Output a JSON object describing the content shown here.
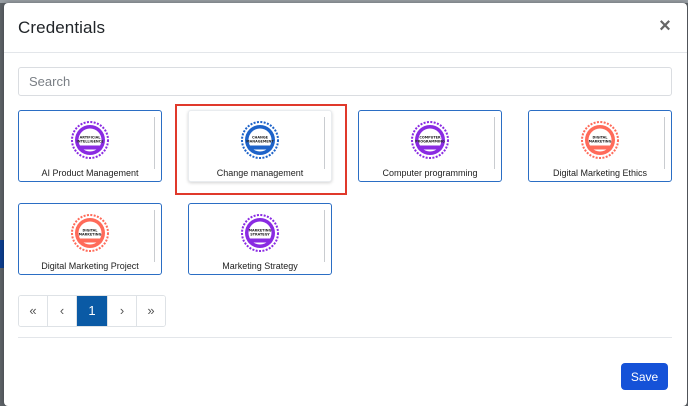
{
  "dialog": {
    "title": "Credentials",
    "close_glyph": "×",
    "search_placeholder": "Search",
    "save_label": "Save"
  },
  "credentials": [
    {
      "label": "AI Product Management",
      "badge_text": [
        "ARTIFICIAL",
        "INTELLIGENCE"
      ],
      "badge_color": "#8a2be2",
      "selected": false
    },
    {
      "label": "Change management",
      "badge_text": [
        "CHANGE",
        "MANAGEMENT"
      ],
      "badge_color": "#1e63c9",
      "selected": true
    },
    {
      "label": "Computer programming",
      "badge_text": [
        "COMPUTER",
        "PROGRAMMING"
      ],
      "badge_color": "#8a2be2",
      "selected": false
    },
    {
      "label": "Digital Marketing Ethics",
      "badge_text": [
        "DIGITAL",
        "MARKETING"
      ],
      "badge_color": "#ff6b5a",
      "selected": false
    },
    {
      "label": "Digital Marketing Project",
      "badge_text": [
        "DIGITAL",
        "MARKETING"
      ],
      "badge_color": "#ff6b5a",
      "selected": false
    },
    {
      "label": "Marketing Strategy",
      "badge_text": [
        "MARKETING",
        "STRATEGY"
      ],
      "badge_color": "#8a2be2",
      "selected": false
    }
  ],
  "pagination": {
    "first": "«",
    "prev": "‹",
    "current": "1",
    "next": "›",
    "last": "»"
  },
  "colors": {
    "accent": "#1552d8",
    "card_border": "#2b6ec4",
    "highlight": "#e0392b"
  }
}
